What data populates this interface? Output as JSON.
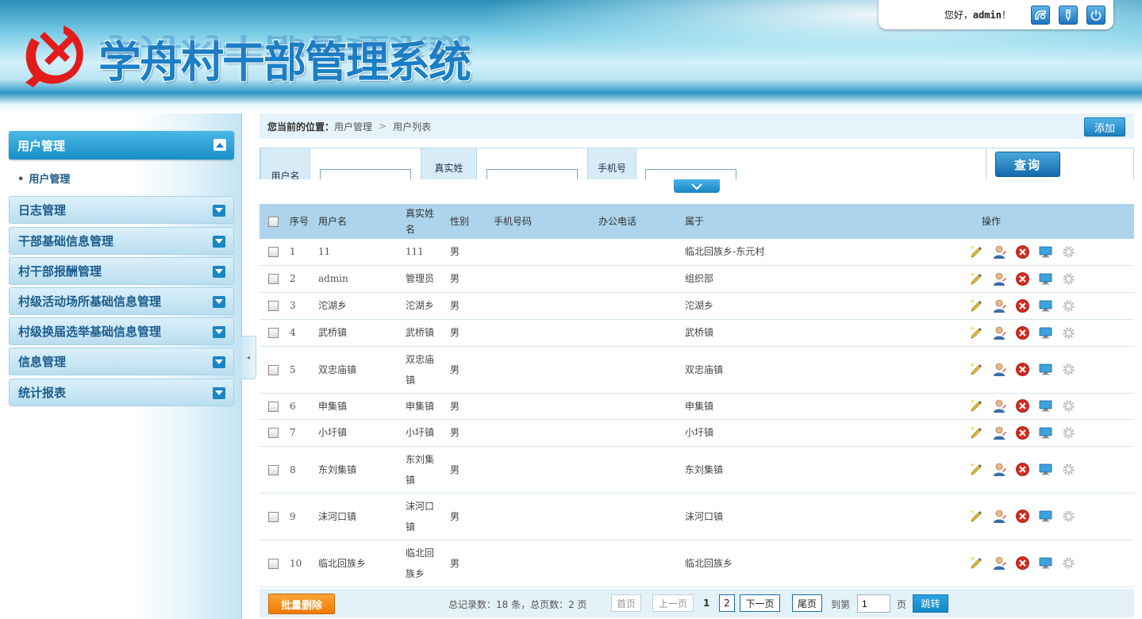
{
  "header": {
    "title": "学舟村干部管理系统",
    "greeting_prefix": "您好，",
    "username": "admin",
    "greeting_suffix": "！",
    "buttons": [
      "home-icon",
      "edit-icon",
      "power-icon"
    ]
  },
  "sidebar": {
    "active_menu": "用户管理",
    "active_submenu": "用户管理",
    "menus": [
      "日志管理",
      "干部基础信息管理",
      "村干部报酬管理",
      "村级活动场所基础信息管理",
      "村级换届选举基础信息管理",
      "信息管理",
      "统计报表"
    ]
  },
  "breadcrumb": {
    "lead": "您当前的位置：",
    "items": [
      "用户管理",
      "用户列表"
    ],
    "add_button": "添加"
  },
  "search": {
    "username_label": "用户名",
    "realname_label": "真实姓",
    "phone_label": "手机号",
    "username_value": "",
    "realname_value": "",
    "phone_value": "",
    "query_button": "查询"
  },
  "table": {
    "headers": [
      "序号",
      "用户名",
      "真实姓名",
      "性别",
      "手机号码",
      "办公电话",
      "属于",
      "操作"
    ],
    "rows": [
      {
        "idx": "1",
        "username": "11",
        "realname": "111",
        "gender": "男",
        "phone": "",
        "office": "",
        "belongs": "临北回族乡-东元村"
      },
      {
        "idx": "2",
        "username": "admin",
        "realname": "管理员",
        "gender": "男",
        "phone": "",
        "office": "",
        "belongs": "组织部"
      },
      {
        "idx": "3",
        "username": "沱湖乡",
        "realname": "沱湖乡",
        "gender": "男",
        "phone": "",
        "office": "",
        "belongs": "沱湖乡"
      },
      {
        "idx": "4",
        "username": "武桥镇",
        "realname": "武桥镇",
        "gender": "男",
        "phone": "",
        "office": "",
        "belongs": "武桥镇"
      },
      {
        "idx": "5",
        "username": "双忠庙镇",
        "realname": "双忠庙镇",
        "gender": "男",
        "phone": "",
        "office": "",
        "belongs": "双忠庙镇"
      },
      {
        "idx": "6",
        "username": "申集镇",
        "realname": "申集镇",
        "gender": "男",
        "phone": "",
        "office": "",
        "belongs": "申集镇"
      },
      {
        "idx": "7",
        "username": "小圩镇",
        "realname": "小圩镇",
        "gender": "男",
        "phone": "",
        "office": "",
        "belongs": "小圩镇"
      },
      {
        "idx": "8",
        "username": "东刘集镇",
        "realname": "东刘集镇",
        "gender": "男",
        "phone": "",
        "office": "",
        "belongs": "东刘集镇"
      },
      {
        "idx": "9",
        "username": "沫河口镇",
        "realname": "沫河口镇",
        "gender": "男",
        "phone": "",
        "office": "",
        "belongs": "沫河口镇"
      },
      {
        "idx": "10",
        "username": "临北回族乡",
        "realname": "临北回族乡",
        "gender": "男",
        "phone": "",
        "office": "",
        "belongs": "临北回族乡"
      }
    ],
    "row_actions": [
      "edit-icon",
      "user-role-icon",
      "delete-icon",
      "monitor-icon",
      "gear-icon"
    ]
  },
  "footer": {
    "batch_delete": "批量删除",
    "total_records": "总记录数：18 条，总页数：2 页",
    "first": "首页",
    "prev": "上一页",
    "page1": "1",
    "page2": "2",
    "next": "下一页",
    "last": "尾页",
    "goto_prefix": "到第",
    "goto_value": "1",
    "goto_suffix": "页",
    "jump": "跳转"
  },
  "colors": {
    "accent": "#1b86c4",
    "table_header_bg": "#add4ec",
    "batch_delete": "#f58a0f"
  }
}
